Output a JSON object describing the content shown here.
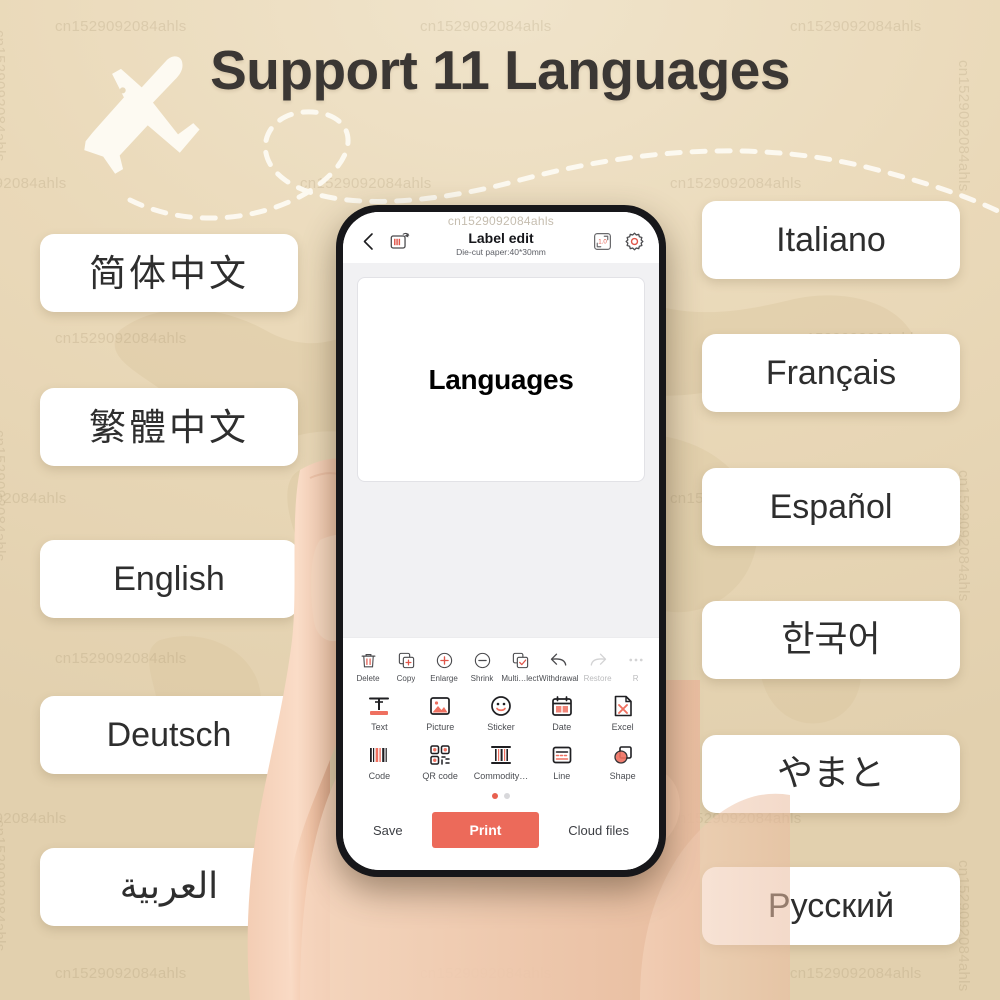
{
  "page": {
    "title": "Support 11 Languages",
    "background_color": "#e8d9bb",
    "watermark_text": "cn1529092084ahls"
  },
  "languages_left": [
    {
      "label": "简体中文",
      "script": "cjk"
    },
    {
      "label": "繁體中文",
      "script": "cjk"
    },
    {
      "label": "English",
      "script": "latin"
    },
    {
      "label": "Deutsch",
      "script": "latin"
    },
    {
      "label": "العربية",
      "script": "arabic"
    }
  ],
  "languages_right": [
    {
      "label": "Italiano",
      "script": "latin"
    },
    {
      "label": "Français",
      "script": "latin"
    },
    {
      "label": "Español",
      "script": "latin"
    },
    {
      "label": "한국어",
      "script": "korean"
    },
    {
      "label": "やまと",
      "script": "japanese"
    },
    {
      "label": "Русский",
      "script": "cyrillic"
    }
  ],
  "phone": {
    "app": {
      "header": {
        "watermark": "cn1529092084ahls",
        "title": "Label edit",
        "subtitle": "Die-cut paper:40*30mm",
        "back_icon": "chevron-left-icon",
        "printer_icon": "printer-icon",
        "size_icon": "label-size-icon",
        "size_icon_value": "1.0",
        "settings_icon": "gear-icon"
      },
      "canvas": {
        "label_text": "Languages"
      },
      "toolbar_row1": [
        {
          "label": "Delete",
          "icon": "trash-icon",
          "disabled": false
        },
        {
          "label": "Copy",
          "icon": "copy-icon",
          "disabled": false
        },
        {
          "label": "Enlarge",
          "icon": "plus-circle-icon",
          "disabled": false
        },
        {
          "label": "Shrink",
          "icon": "minus-circle-icon",
          "disabled": false
        },
        {
          "label": "Multi…lect",
          "icon": "multiselect-icon",
          "disabled": false
        },
        {
          "label": "Withdrawal",
          "icon": "undo-icon",
          "disabled": false
        },
        {
          "label": "Restore",
          "icon": "redo-icon",
          "disabled": true
        },
        {
          "label": "R",
          "icon": "more-icon",
          "disabled": true
        }
      ],
      "toolbar_row2": [
        {
          "label": "Text",
          "icon": "text-tool-icon"
        },
        {
          "label": "Picture",
          "icon": "image-icon"
        },
        {
          "label": "Sticker",
          "icon": "smiley-icon"
        },
        {
          "label": "Date",
          "icon": "calendar-icon"
        },
        {
          "label": "Excel",
          "icon": "excel-icon"
        }
      ],
      "toolbar_row3": [
        {
          "label": "Code",
          "icon": "barcode-icon"
        },
        {
          "label": "QR code",
          "icon": "qrcode-icon"
        },
        {
          "label": "Commodity…",
          "icon": "commodity-icon"
        },
        {
          "label": "Line",
          "icon": "line-icon"
        },
        {
          "label": "Shape",
          "icon": "shape-icon"
        }
      ],
      "pager": {
        "pages": 2,
        "active": 1
      },
      "bottom_bar": {
        "save_label": "Save",
        "print_label": "Print",
        "cloud_label": "Cloud files",
        "print_color": "#ec6a5a"
      }
    }
  }
}
